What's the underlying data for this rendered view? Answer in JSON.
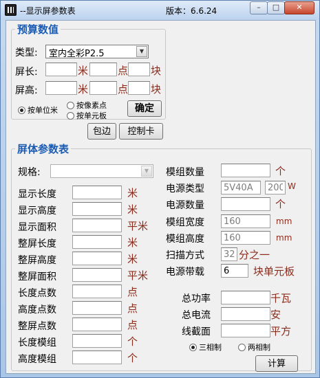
{
  "window": {
    "title": "--显示屏参数表",
    "version": "版本：6.6.24",
    "min_glyph": "–",
    "max_glyph": "□",
    "close_glyph": "✕"
  },
  "budget": {
    "group_title": "预算数值",
    "type_label": "类型:",
    "type_value": "室内全彩P2.5",
    "width_label": "屏长:",
    "height_label": "屏高:",
    "unit_m": "米",
    "unit_dot": "点",
    "unit_block": "块",
    "width_m": "",
    "width_dot": "",
    "width_block": "",
    "height_m": "",
    "height_dot": "",
    "height_block": "",
    "radio_meter": "按单位米",
    "radio_pixel": "按像素点",
    "radio_module": "按单元板",
    "confirm_button": "确定",
    "wrap_button": "包边",
    "control_card_button": "控制卡"
  },
  "screen": {
    "group_title": "屏体参数表",
    "spec_label": "规格:",
    "spec_value": "",
    "left_rows": [
      {
        "label": "显示长度",
        "value": "",
        "unit": "米"
      },
      {
        "label": "显示高度",
        "value": "",
        "unit": "米"
      },
      {
        "label": "显示面积",
        "value": "",
        "unit": "平米"
      },
      {
        "label": "整屏长度",
        "value": "",
        "unit": "米"
      },
      {
        "label": "整屏高度",
        "value": "",
        "unit": "米"
      },
      {
        "label": "整屏面积",
        "value": "",
        "unit": "平米"
      },
      {
        "label": "长度点数",
        "value": "",
        "unit": "点"
      },
      {
        "label": "高度点数",
        "value": "",
        "unit": "点"
      },
      {
        "label": "整屏点数",
        "value": "",
        "unit": "点"
      },
      {
        "label": "长度模组",
        "value": "",
        "unit": "个"
      },
      {
        "label": "高度模组",
        "value": "",
        "unit": "个"
      }
    ],
    "module_count_label": "模组数量",
    "module_count_value": "",
    "module_count_unit": "个",
    "psu_type_label": "电源类型",
    "psu_type_value": "5V40A",
    "psu_watt_value": "200",
    "psu_watt_unit": "W",
    "psu_count_label": "电源数量",
    "psu_count_value": "",
    "psu_count_unit": "个",
    "module_width_label": "模组宽度",
    "module_width_value": "160",
    "module_width_unit": "mm",
    "module_height_label": "模组高度",
    "module_height_value": "160",
    "module_height_unit": "mm",
    "scan_label": "扫描方式",
    "scan_value": "32",
    "scan_unit": "分之一",
    "psu_load_label": "电源带载",
    "psu_load_value": "6",
    "psu_load_unit": "块单元板",
    "total_power_label": "总功率",
    "total_power_value": "",
    "total_power_unit": "千瓦",
    "total_current_label": "总电流",
    "total_current_value": "",
    "total_current_unit": "安",
    "wire_label": "线截面",
    "wire_value": "",
    "wire_unit": "平方",
    "radio_three_phase": "三相制",
    "radio_two_phase": "两相制",
    "calc_button": "计算"
  }
}
